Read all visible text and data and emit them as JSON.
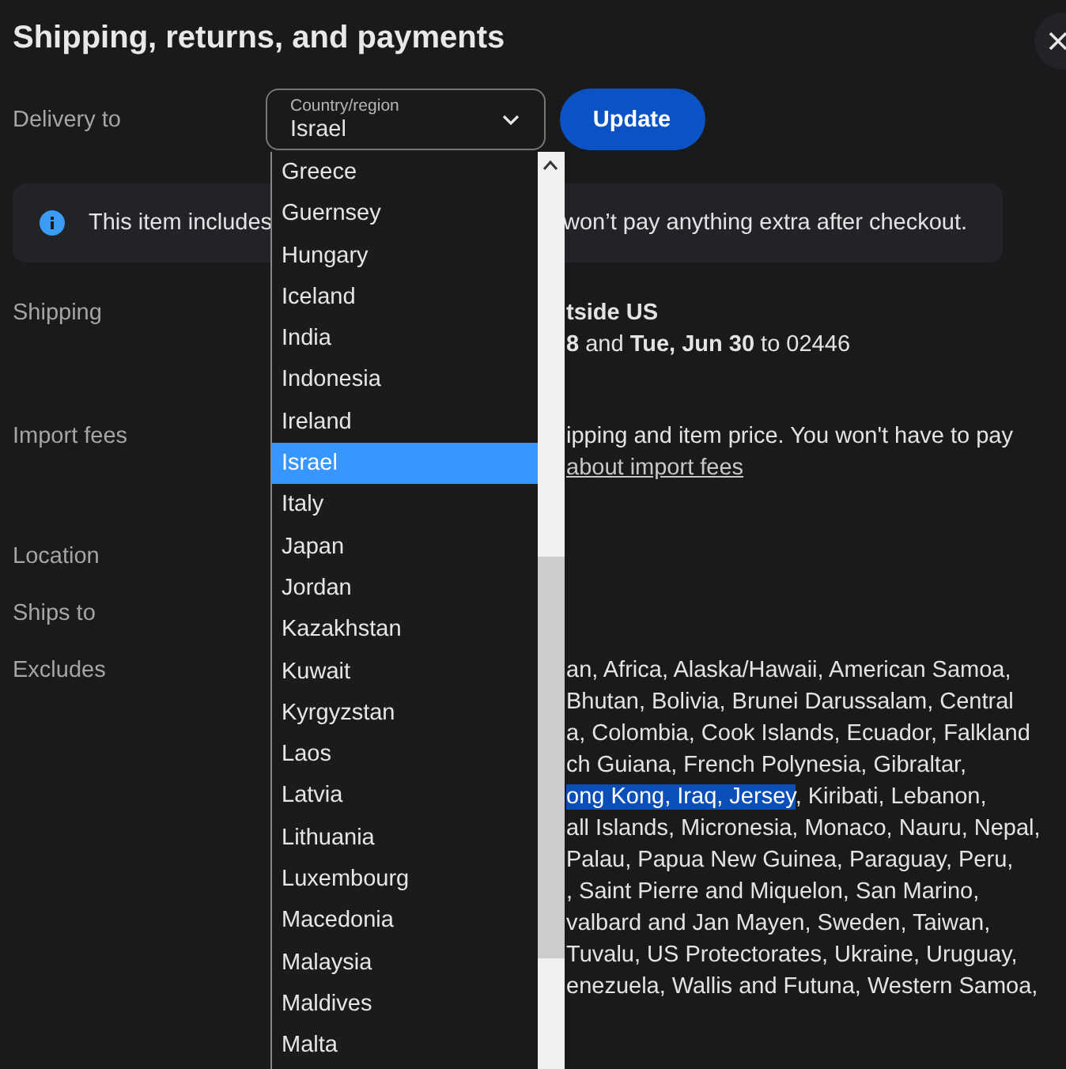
{
  "title": "Shipping, returns, and payments",
  "delivery": {
    "label": "Delivery to",
    "select": {
      "label": "Country/region",
      "value": "Israel"
    },
    "button": "Update"
  },
  "banner": {
    "text_before": "This item includes",
    "text_after": "won’t pay anything extra after checkout."
  },
  "rows": [
    {
      "label": "Shipping",
      "lines": [
        {
          "kind": "bold",
          "text": "tside US"
        },
        {
          "kind": "text",
          "text": "**8** and **Tue, Jun 30** to 02446"
        }
      ]
    },
    {
      "label": "Import fees",
      "lines": [
        {
          "kind": "text",
          "text": "ipping and item price. You won't have to pay"
        },
        {
          "kind": "link",
          "text": "about import fees"
        }
      ]
    },
    {
      "label": "Location",
      "lines": []
    },
    {
      "label": "Ships to",
      "lines": []
    },
    {
      "label": "Excludes",
      "lines": [
        {
          "kind": "text",
          "text": "an, Africa, Alaska/Hawaii, American Samoa,"
        },
        {
          "kind": "text",
          "text": "Bhutan, Bolivia, Brunei Darussalam, Central"
        },
        {
          "kind": "text",
          "text": "a, Colombia, Cook Islands, Ecuador, Falkland"
        },
        {
          "kind": "text",
          "text": "ch Guiana, French Polynesia, Gibraltar,"
        },
        {
          "kind": "selection",
          "highlight": "ong Kong, Iraq, Jersey",
          "text": ", Kiribati, Lebanon,"
        },
        {
          "kind": "text",
          "text": "all Islands, Micronesia, Monaco, Nauru, Nepal,"
        },
        {
          "kind": "text",
          "text": "Palau, Papua New Guinea, Paraguay, Peru,"
        },
        {
          "kind": "text",
          "text": ", Saint Pierre and Miquelon, San Marino,"
        },
        {
          "kind": "text",
          "text": "valbard and Jan Mayen, Sweden, Taiwan,"
        },
        {
          "kind": "text",
          "text": "Tuvalu, US Protectorates, Ukraine, Uruguay,"
        },
        {
          "kind": "text",
          "text": "enezuela, Wallis and Futuna, Western Samoa,"
        }
      ]
    }
  ],
  "countries": [
    {
      "name": "Greece",
      "selected": false
    },
    {
      "name": "Guernsey",
      "selected": false
    },
    {
      "name": "Hungary",
      "selected": false
    },
    {
      "name": "Iceland",
      "selected": false
    },
    {
      "name": "India",
      "selected": false
    },
    {
      "name": "Indonesia",
      "selected": false
    },
    {
      "name": "Ireland",
      "selected": false
    },
    {
      "name": "Israel",
      "selected": true
    },
    {
      "name": "Italy",
      "selected": false
    },
    {
      "name": "Japan",
      "selected": false
    },
    {
      "name": "Jordan",
      "selected": false
    },
    {
      "name": "Kazakhstan",
      "selected": false
    },
    {
      "name": "Kuwait",
      "selected": false
    },
    {
      "name": "Kyrgyzstan",
      "selected": false
    },
    {
      "name": "Laos",
      "selected": false
    },
    {
      "name": "Latvia",
      "selected": false
    },
    {
      "name": "Lithuania",
      "selected": false
    },
    {
      "name": "Luxembourg",
      "selected": false
    },
    {
      "name": "Macedonia",
      "selected": false
    },
    {
      "name": "Malaysia",
      "selected": false
    },
    {
      "name": "Maldives",
      "selected": false
    },
    {
      "name": "Malta",
      "selected": false
    }
  ]
}
